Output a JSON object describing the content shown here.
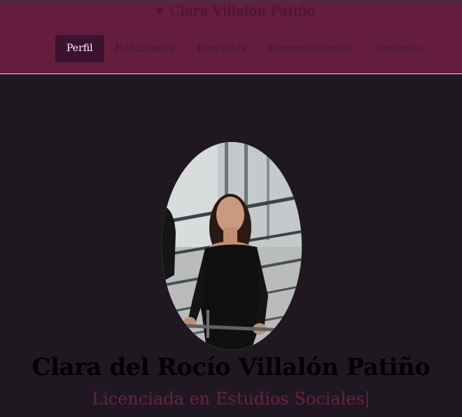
{
  "header": {
    "brand_icon": "snowflake-icon",
    "brand_glyph": "❄",
    "brand_title": "Clara Villalón Patiño",
    "nav": [
      {
        "label": "Perfil",
        "active": true
      },
      {
        "label": "Habilidades",
        "active": false
      },
      {
        "label": "Proyectos",
        "active": false
      },
      {
        "label": "Reconocimientos",
        "active": false
      },
      {
        "label": "Contacto",
        "active": false
      }
    ]
  },
  "hero": {
    "name": "Clara del Rocío Villalón Patiño",
    "subtitle": "Licenciada en Estudios Sociales|"
  },
  "colors": {
    "header_bg": "#651d3d",
    "page_bg": "#201820",
    "active_nav_bg": "#3b1230",
    "accent": "#6b2142"
  }
}
